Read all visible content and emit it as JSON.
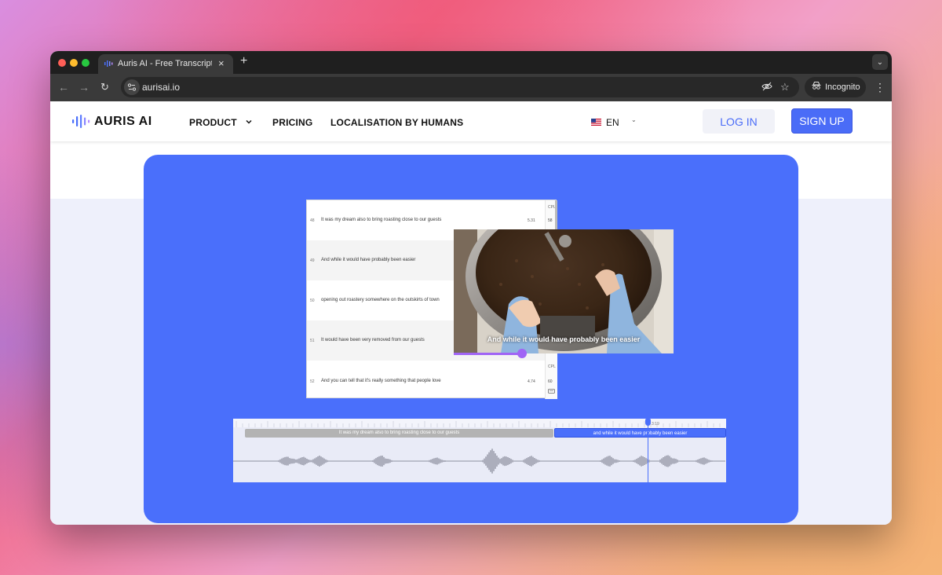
{
  "browser": {
    "tab_title": "Auris AI - Free Transcription,",
    "tab_close": "×",
    "new_tab": "+",
    "url": "aurisai.io",
    "incognito_label": "Incognito"
  },
  "header": {
    "logo_text": "AURIS AI",
    "nav": {
      "product": "PRODUCT",
      "pricing": "PRICING",
      "localisation": "LOCALISATION BY HUMANS"
    },
    "language": "EN",
    "login_label": "LOG IN",
    "signup_label": "SIGN UP"
  },
  "editor": {
    "cpl_label": "CPL",
    "segments": [
      {
        "num": "48",
        "text": "It was my dream also to bring roasting close to our guests",
        "duration": "5.31",
        "cpl": "58"
      },
      {
        "num": "49",
        "text": "And while it would have probably been easier",
        "duration": "",
        "cpl": ""
      },
      {
        "num": "50",
        "text": "opening out roastery somewhere on the outskirts of town",
        "duration": "",
        "cpl": ""
      },
      {
        "num": "51",
        "text": "It would have been very removed from our guests",
        "duration": "",
        "cpl": ""
      },
      {
        "num": "52",
        "text": "And you can tell that it's really something that people love",
        "duration": "4.74",
        "cpl": "60"
      }
    ]
  },
  "video": {
    "subtitle": "And while it would have probably been easier",
    "progress": 0.31
  },
  "timeline": {
    "segment_a": "It was my dream also to bring roasting close to our guests",
    "segment_b": "and while it would have probably been easier",
    "playhead_time": "3:19"
  },
  "colors": {
    "brand_blue": "#4a6ffb",
    "progress_purple": "#a064f5"
  }
}
